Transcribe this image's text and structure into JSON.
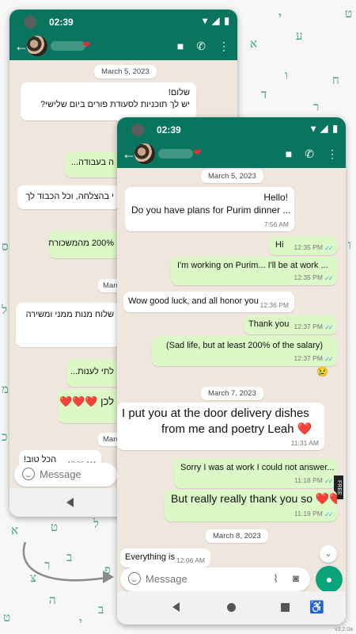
{
  "colors": {
    "header": "#09755f",
    "outgoing_bubble": "#dcf8c6",
    "incoming_bubble": "#ffffff",
    "wallpaper": "#efe7de",
    "read_ticks": "#34b7f1",
    "mic_button": "#09a37c",
    "letters": "#1f8f64"
  },
  "icons": [
    "back-arrow-icon",
    "video-call-icon",
    "phone-call-icon",
    "menu-dots-icon",
    "emoji-icon",
    "attach-icon",
    "camera-icon",
    "mic-icon",
    "wifi-icon",
    "signal-icon",
    "battery-icon",
    "chevron-down-icon"
  ],
  "background_letters": [
    "ט",
    "י",
    "ע",
    "א",
    "ח",
    "ו",
    "ד",
    "ר",
    "ס",
    "ל",
    "מ",
    "כ",
    "א",
    "ט",
    "ל",
    "ב",
    "ר",
    "צ",
    "ה",
    "פ",
    "ב",
    "ט",
    "י",
    "ו",
    "ק",
    "ג",
    "ל",
    "ה",
    "ב",
    "ח"
  ],
  "back_phone": {
    "clock": "02:39",
    "date_chip_1": "March 5, 2023",
    "date_chip_2": "Marc",
    "date_chip_3": "Marc",
    "messages": [
      {
        "text_1": "שלום!",
        "text_2": "יש לך תוכניות לסעודת פורים ביום שלישי?"
      },
      {
        "text": "ה בעבודה..."
      },
      {
        "text": "י בהצלחה, וכל הכבוד לך"
      },
      {
        "text": "200% מהמשכורת)"
      },
      {
        "text": "שלוח מנות ממני ומשירה"
      },
      {
        "text": "לתי לענות..."
      },
      {
        "text": "לכן ❤️❤️❤️"
      },
      {
        "text": "הכל טוב!",
        "time": "12:06 AM"
      }
    ],
    "input_placeholder": "Message"
  },
  "front_phone": {
    "clock": "02:39",
    "date_chips": [
      "March 5, 2023",
      "March 7, 2023",
      "March 8, 2023"
    ],
    "messages": [
      {
        "line1": "Hello!",
        "line2": "Do you have plans for Purim dinner ...",
        "time": "7:56 AM"
      },
      {
        "text": "Hi",
        "time": "12:35 PM"
      },
      {
        "text": "I'm working on Purim... I'll be at work ...",
        "time": "12:35 PM"
      },
      {
        "text": "Wow good luck, and all honor you",
        "time": "12:36 PM"
      },
      {
        "text": "Thank you",
        "time": "12:37 PM"
      },
      {
        "text": "(Sad life, but at least 200% of the salary)",
        "time": "12:37 PM"
      },
      {
        "line1": "I put you at the door delivery dishes",
        "line2": "from me and poetry Leah ❤️",
        "time": "11:31 AM"
      },
      {
        "text": "Sorry I was at work I could not answer...",
        "time": "11:18 PM"
      },
      {
        "text": "But really really thank you so ❤️❤️❤️",
        "time": "11:19 PM"
      },
      {
        "text": "Everything is",
        "time": "12:06 AM"
      }
    ],
    "reaction": "😢",
    "input_placeholder": "Message",
    "side_label": "FREE"
  },
  "version": "v3.2.0a"
}
